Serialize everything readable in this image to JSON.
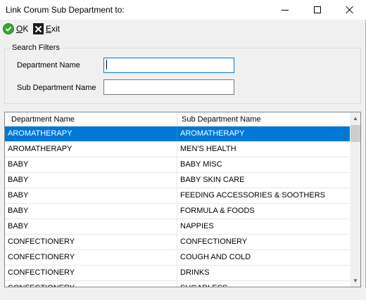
{
  "window": {
    "title": "Link Corum Sub Department to:"
  },
  "toolbar": {
    "ok_label_underlined": "O",
    "ok_label_rest": "K",
    "exit_label_underlined": "E",
    "exit_label_rest": "xit",
    "ok_icon": "green-check-icon",
    "exit_icon": "black-x-icon"
  },
  "filters": {
    "group_title": "Search Filters",
    "department_label": "Department Name",
    "department_value": "",
    "sub_department_label": "Sub Department Name",
    "sub_department_value": ""
  },
  "grid": {
    "columns": [
      "Department Name",
      "Sub Department Name"
    ],
    "rows": [
      [
        "AROMATHERAPY",
        "AROMATHERAPY"
      ],
      [
        "AROMATHERAPY",
        "MEN'S HEALTH"
      ],
      [
        "BABY",
        "BABY MISC"
      ],
      [
        "BABY",
        "BABY SKIN CARE"
      ],
      [
        "BABY",
        "FEEDING ACCESSORIES & SOOTHERS"
      ],
      [
        "BABY",
        "FORMULA & FOODS"
      ],
      [
        "BABY",
        "NAPPIES"
      ],
      [
        "CONFECTIONERY",
        "CONFECTIONERY"
      ],
      [
        "CONFECTIONERY",
        "COUGH AND COLD"
      ],
      [
        "CONFECTIONERY",
        "DRINKS"
      ],
      [
        "CONFECTIONERY",
        "SUGARLESS"
      ]
    ],
    "selected_row_index": 0
  },
  "colors": {
    "selection": "#0078d7",
    "ok_icon": "#3aa635",
    "exit_icon": "#1b1b1b"
  }
}
